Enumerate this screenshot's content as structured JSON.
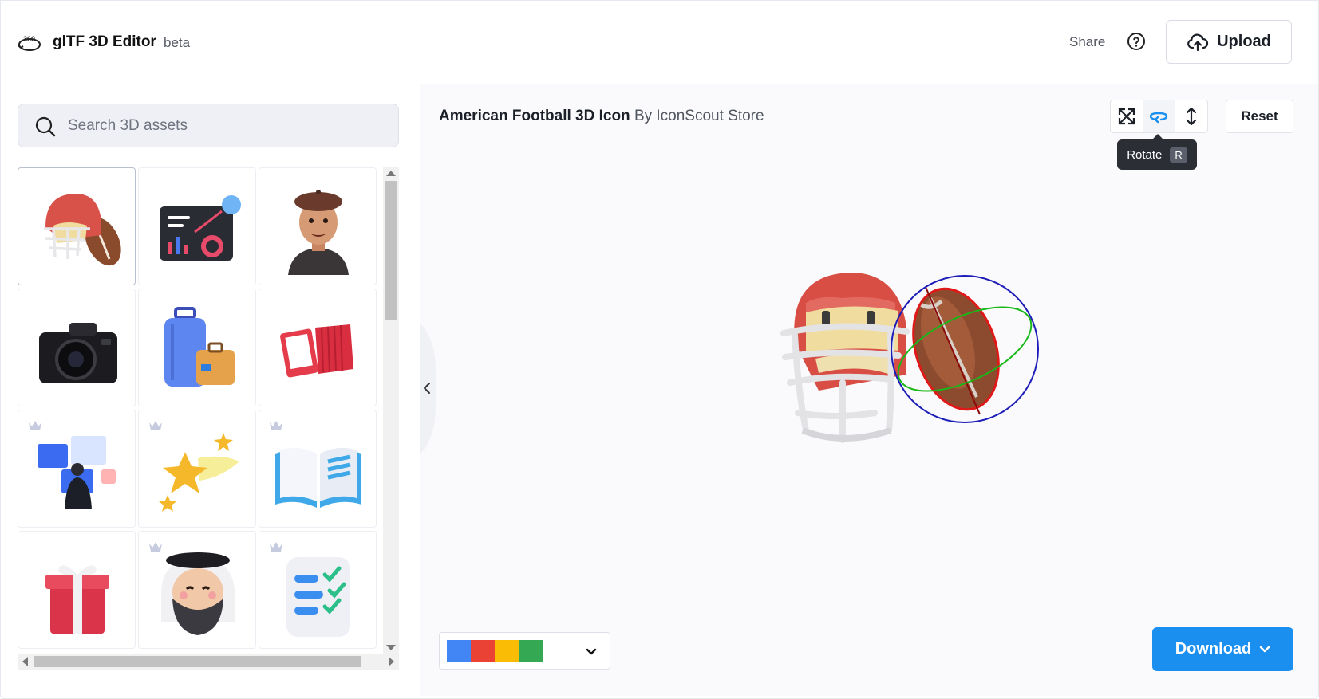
{
  "header": {
    "logo_icon": "360-rotate-icon",
    "app_title": "glTF 3D Editor",
    "badge": "beta",
    "share_label": "Share",
    "help_icon": "question-circle-icon",
    "upload_label": "Upload",
    "upload_icon": "cloud-upload-icon"
  },
  "sidebar": {
    "search_placeholder": "Search 3D assets",
    "search_icon": "search-icon",
    "assets": [
      {
        "name": "football-helmet",
        "premium": false,
        "selected": true
      },
      {
        "name": "analytics-dashboard",
        "premium": false,
        "selected": false
      },
      {
        "name": "man-avatar-beret",
        "premium": false,
        "selected": false
      },
      {
        "name": "camera",
        "premium": false,
        "selected": false
      },
      {
        "name": "luggage",
        "premium": false,
        "selected": false
      },
      {
        "name": "accordion",
        "premium": false,
        "selected": false
      },
      {
        "name": "businessman-screens",
        "premium": true,
        "selected": false
      },
      {
        "name": "shooting-stars",
        "premium": true,
        "selected": false
      },
      {
        "name": "open-book",
        "premium": true,
        "selected": false
      },
      {
        "name": "gift-box",
        "premium": false,
        "selected": false
      },
      {
        "name": "arab-man-avatar",
        "premium": true,
        "selected": false
      },
      {
        "name": "checklist",
        "premium": true,
        "selected": false
      }
    ]
  },
  "viewer": {
    "asset_name": "American Football 3D Icon",
    "by_text": "By IconScout Store",
    "tools": [
      {
        "name": "scale",
        "icon": "expand-arrows-icon",
        "active": false
      },
      {
        "name": "rotate",
        "icon": "rotate-icon",
        "active": true
      },
      {
        "name": "move",
        "icon": "vertical-arrows-icon",
        "active": false
      }
    ],
    "tooltip_label": "Rotate",
    "tooltip_key": "R",
    "reset_label": "Reset",
    "colors": [
      "#4285f4",
      "#ea4335",
      "#fbbc05",
      "#34a853"
    ],
    "download_label": "Download",
    "accent_color": "#1b8ff0"
  }
}
